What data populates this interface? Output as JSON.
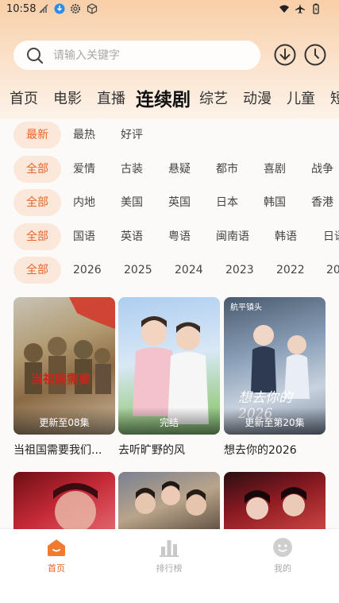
{
  "status_bar": {
    "time": "10:58"
  },
  "search": {
    "placeholder": "请输入关键字"
  },
  "top_tabs": [
    {
      "label": "首页"
    },
    {
      "label": "电影"
    },
    {
      "label": "直播"
    },
    {
      "label": "连续剧",
      "active": true
    },
    {
      "label": "综艺"
    },
    {
      "label": "动漫"
    },
    {
      "label": "儿童"
    },
    {
      "label": "短"
    }
  ],
  "filters": {
    "sort": [
      "最新",
      "最热",
      "好评"
    ],
    "genre": [
      "全部",
      "爱情",
      "古装",
      "悬疑",
      "都市",
      "喜剧",
      "战争"
    ],
    "region": [
      "全部",
      "内地",
      "美国",
      "英国",
      "日本",
      "韩国",
      "香港"
    ],
    "language": [
      "全部",
      "国语",
      "英语",
      "粤语",
      "闽南语",
      "韩语",
      "日语"
    ],
    "year": [
      "全部",
      "2026",
      "2025",
      "2024",
      "2023",
      "2022",
      "20"
    ]
  },
  "cards": [
    {
      "title": "当祖国需要我们...",
      "status": "更新至08集",
      "poster_text": "当祖国需要"
    },
    {
      "title": "去听旷野的风",
      "status": "完结",
      "poster_text": ""
    },
    {
      "title": "想去你的2026",
      "status": "更新至第20集",
      "poster_text": "想去你的2026",
      "poster_top": "航平镇头"
    }
  ],
  "bottom_nav": [
    {
      "label": "首页",
      "icon": "home-icon",
      "active": true
    },
    {
      "label": "排行榜",
      "icon": "ranking-icon"
    },
    {
      "label": "我的",
      "icon": "profile-icon"
    }
  ],
  "colors": {
    "accent": "#e8652a",
    "chip_active_bg": "#fbe8db"
  }
}
